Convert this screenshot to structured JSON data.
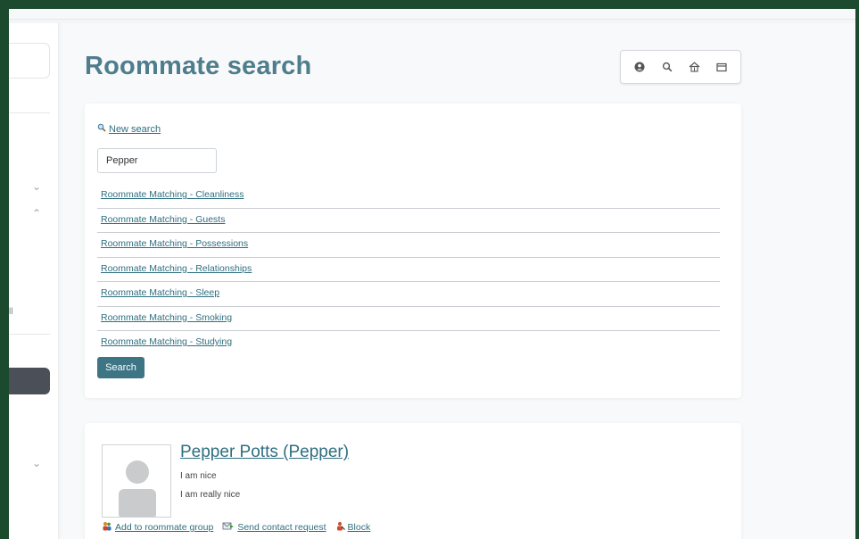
{
  "page": {
    "title": "Roommate search"
  },
  "sidebar": {
    "partial_label": "ll"
  },
  "toolbar": {
    "buttons": [
      {
        "icon": "user-circle-icon"
      },
      {
        "icon": "search-icon"
      },
      {
        "icon": "home-icon"
      },
      {
        "icon": "window-icon"
      }
    ]
  },
  "search": {
    "new_search_label": "New search",
    "query_value": "Pepper",
    "filters": [
      "Roommate Matching - Cleanliness",
      "Roommate Matching - Guests",
      "Roommate Matching - Possessions",
      "Roommate Matching - Relationships",
      "Roommate Matching - Sleep",
      "Roommate Matching - Smoking",
      "Roommate Matching - Studying"
    ],
    "button_label": "Search"
  },
  "result": {
    "name": "Pepper Potts (Pepper)",
    "line1": "I am nice",
    "line2": "I am really nice",
    "actions": {
      "add_group": "Add to roommate group",
      "contact": "Send contact request",
      "block": "Block"
    }
  },
  "colors": {
    "accent": "#3d7585",
    "link": "#2f6f80",
    "title": "#4e7d8c",
    "frame": "#1b4a2e"
  }
}
